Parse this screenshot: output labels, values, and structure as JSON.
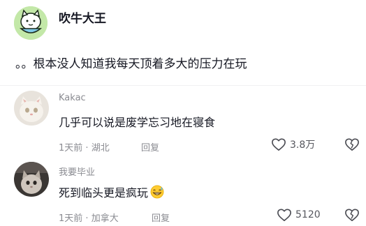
{
  "post": {
    "author": "吹牛大王",
    "text": "。。根本没人知道我每天顶着多大的压力在玩"
  },
  "comments": [
    {
      "username": "Kakac",
      "text": "几乎可以说是废学忘习地在寝食",
      "time": "1天前",
      "location": "湖北",
      "reply_label": "回复",
      "likes": "3.8万"
    },
    {
      "username": "我要毕业",
      "text": "死到临头更是疯玩",
      "time": "1天前",
      "location": "加拿大",
      "reply_label": "回复",
      "likes": "5120"
    }
  ]
}
